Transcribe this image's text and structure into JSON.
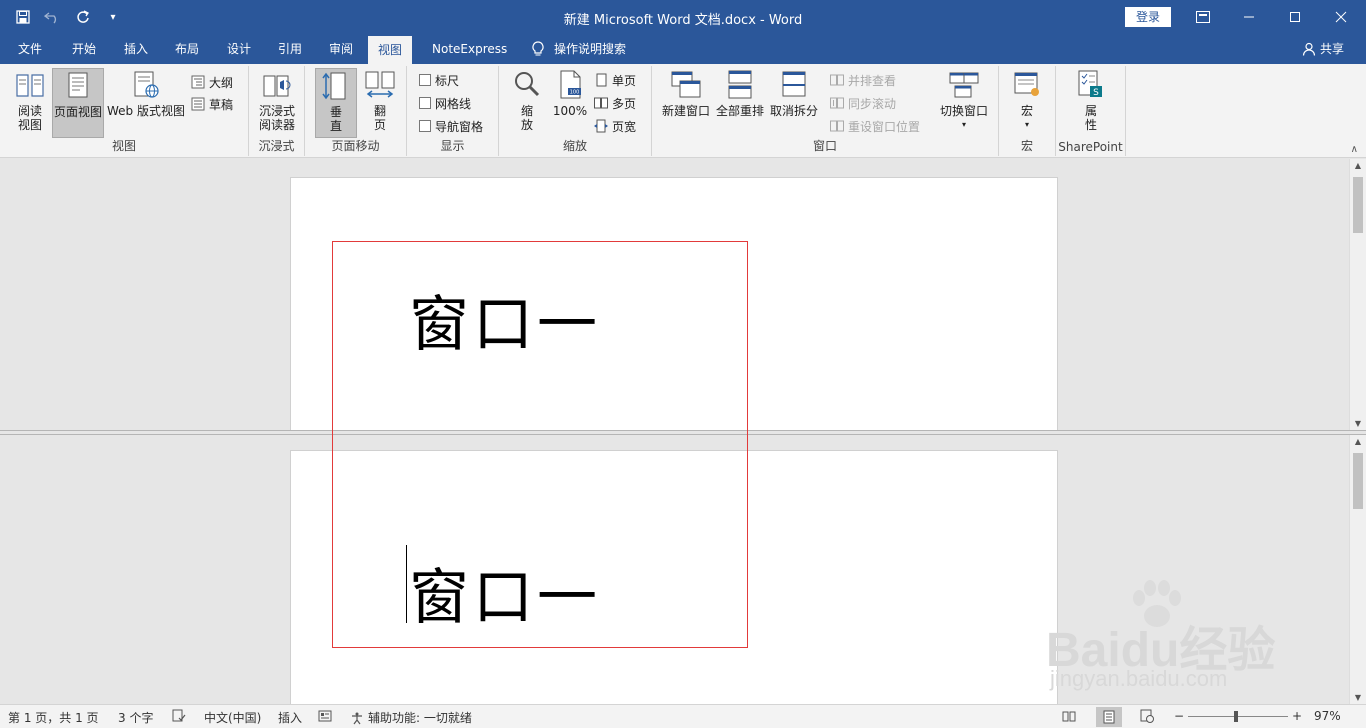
{
  "window": {
    "title": "新建 Microsoft Word 文档.docx  -  Word",
    "login_label": "登录"
  },
  "tabs": [
    {
      "label": "文件"
    },
    {
      "label": "开始"
    },
    {
      "label": "插入"
    },
    {
      "label": "布局"
    },
    {
      "label": "设计"
    },
    {
      "label": "引用"
    },
    {
      "label": "审阅"
    },
    {
      "label": "视图"
    },
    {
      "label": "NoteExpress"
    }
  ],
  "tell_me": "操作说明搜索",
  "share_label": "共享",
  "ribbon": {
    "views": {
      "read_mode": "阅读\n视图",
      "print_layout": "页面视图",
      "web_layout": "Web 版式视图",
      "outline": "大纲",
      "draft": "草稿",
      "label": "视图"
    },
    "immersive": {
      "reader": "沉浸式\n阅读器",
      "label": "沉浸式"
    },
    "page_move": {
      "vertical": "垂\n直",
      "side": "翻\n页",
      "label": "页面移动"
    },
    "show": {
      "ruler": "标尺",
      "gridlines": "网格线",
      "nav_pane": "导航窗格",
      "label": "显示"
    },
    "zoom": {
      "zoom": "缩\n放",
      "hundred": "100%",
      "one_page": "单页",
      "multi_page": "多页",
      "page_width": "页宽",
      "label": "缩放"
    },
    "window": {
      "new_window": "新建窗口",
      "arrange_all": "全部重排",
      "remove_split": "取消拆分",
      "side_by_side": "并排查看",
      "sync_scroll": "同步滚动",
      "reset_pos": "重设窗口位置",
      "switch": "切换窗口",
      "label": "窗口"
    },
    "macros": {
      "macros": "宏",
      "label": "宏"
    },
    "sharepoint": {
      "properties": "属\n性",
      "label": "SharePoint"
    }
  },
  "document": {
    "text": "窗口一"
  },
  "status": {
    "page": "第 1 页，共 1 页",
    "words": "3 个字",
    "language": "中文(中国)",
    "mode": "插入",
    "accessibility": "辅助功能: 一切就绪",
    "zoom": "97%"
  },
  "watermark": {
    "brand": "Baidu经验",
    "url": "jingyan.baidu.com"
  },
  "colors": {
    "brand_blue": "#2b579a",
    "highlight_red": "#e23a3a"
  }
}
